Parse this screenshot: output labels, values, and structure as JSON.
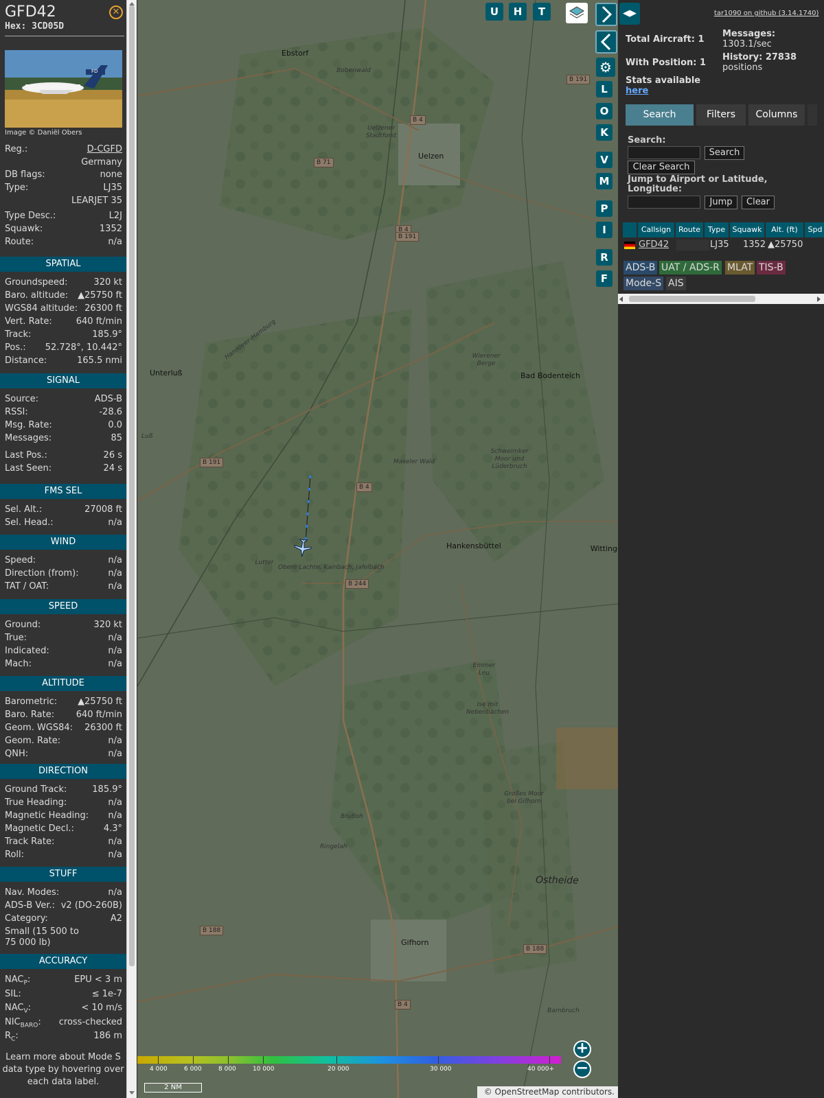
{
  "aircraft": {
    "callsign": "GFD42",
    "hex_label": "Hex: 3CD05D",
    "image_credit": "Image © Daniël Obers",
    "photo_tail_text": "FD",
    "info_rows": [
      {
        "label": "Reg.:",
        "value": "D-CGFD"
      },
      {
        "label": "",
        "value": "Germany"
      },
      {
        "label": "DB flags:",
        "value": "none"
      },
      {
        "label": "Type:",
        "value": "LJ35"
      },
      {
        "label": "",
        "value": "LEARJET 35"
      },
      {
        "label": "Type Desc.:",
        "value": "L2J"
      },
      {
        "label": "Squawk:",
        "value": "1352"
      },
      {
        "label": "Route:",
        "value": "n/a"
      }
    ]
  },
  "sections": [
    {
      "title": "SPATIAL",
      "rows": [
        {
          "label": "Groundspeed:",
          "value": "320 kt"
        },
        {
          "label": "Baro. altitude:",
          "value": "▲25750 ft"
        },
        {
          "label": "WGS84 altitude:",
          "value": "26300 ft"
        },
        {
          "label": "Vert. Rate:",
          "value": "640 ft/min"
        },
        {
          "label": "Track:",
          "value": "185.9°"
        },
        {
          "label": "Pos.:",
          "value": "52.728°, 10.442°"
        },
        {
          "label": "Distance:",
          "value": "165.5 nmi"
        }
      ]
    },
    {
      "title": "SIGNAL",
      "rows": [
        {
          "label": "Source:",
          "value": "ADS-B"
        },
        {
          "label": "RSSI:",
          "value": "-28.6"
        },
        {
          "label": "Msg. Rate:",
          "value": "0.0"
        },
        {
          "label": "Messages:",
          "value": "85"
        },
        {
          "label": "Last Pos.:",
          "value": "26 s"
        },
        {
          "label": "Last Seen:",
          "value": "24 s"
        }
      ]
    },
    {
      "title": "FMS SEL",
      "rows": [
        {
          "label": "Sel. Alt.:",
          "value": "27008 ft"
        },
        {
          "label": "Sel. Head.:",
          "value": "n/a"
        }
      ]
    },
    {
      "title": "WIND",
      "rows": [
        {
          "label": "Speed:",
          "value": "n/a"
        },
        {
          "label": "Direction (from):",
          "value": "n/a"
        },
        {
          "label": "TAT / OAT:",
          "value": "n/a"
        }
      ]
    },
    {
      "title": "SPEED",
      "rows": [
        {
          "label": "Ground:",
          "value": "320 kt"
        },
        {
          "label": "True:",
          "value": "n/a"
        },
        {
          "label": "Indicated:",
          "value": "n/a"
        },
        {
          "label": "Mach:",
          "value": "n/a"
        }
      ]
    },
    {
      "title": "ALTITUDE",
      "rows": [
        {
          "label": "Barometric:",
          "value": "▲25750 ft"
        },
        {
          "label": "Baro. Rate:",
          "value": "640 ft/min"
        },
        {
          "label": "Geom. WGS84:",
          "value": "26300 ft"
        },
        {
          "label": "Geom. Rate:",
          "value": "n/a"
        },
        {
          "label": "QNH:",
          "value": "n/a"
        }
      ]
    },
    {
      "title": "DIRECTION",
      "rows": [
        {
          "label": "Ground Track:",
          "value": "185.9°"
        },
        {
          "label": "True Heading:",
          "value": "n/a"
        },
        {
          "label": "Magnetic Heading:",
          "value": "n/a"
        },
        {
          "label": "Magnetic Decl.:",
          "value": "4.3°"
        },
        {
          "label": "Track Rate:",
          "value": "n/a"
        },
        {
          "label": "Roll:",
          "value": "n/a"
        }
      ]
    },
    {
      "title": "STUFF",
      "rows": [
        {
          "label": "Nav. Modes:",
          "value": "n/a"
        },
        {
          "label": "ADS-B Ver.:",
          "value": "v2 (DO-260B)"
        },
        {
          "label": "Category:",
          "value": "A2"
        },
        {
          "label": "Small (15 500 to",
          "value": ""
        },
        {
          "label": "75 000 lb)",
          "value": ""
        }
      ]
    },
    {
      "title": "ACCURACY",
      "rows": [
        {
          "label": "NAC",
          "sub": "P",
          "tail": ":",
          "value": "EPU < 3 m"
        },
        {
          "label": "SIL:",
          "value": "≤ 1e-7"
        },
        {
          "label": "NAC",
          "sub": "V",
          "tail": ":",
          "value": "< 10 m/s"
        },
        {
          "label": "NIC",
          "sub": "BARO",
          "tail": ":",
          "value": "cross-checked"
        },
        {
          "label": "R",
          "sub": "C",
          "tail": ":",
          "value": "186 m"
        }
      ]
    }
  ],
  "learn_more": "Learn more about Mode S data type by hovering over each data label.",
  "map": {
    "top_buttons": [
      "U",
      "H",
      "T"
    ],
    "side_buttons": [
      "L",
      "O",
      "K",
      "V",
      "M",
      "P",
      "I",
      "R",
      "F"
    ],
    "colorbar_ticks": [
      "4 000",
      "6 000",
      "8 000",
      "10 000",
      "20 000",
      "30 000",
      "40 000+"
    ],
    "scale": "2 NM",
    "attribution": "© OpenStreetMap contributors.",
    "places": [
      {
        "name": "Ebstorf",
        "cls": "town"
      },
      {
        "name": "Bobenwald",
        "cls": "area"
      },
      {
        "name": "Uelzener Stadtforst",
        "cls": "area"
      },
      {
        "name": "Uelzen",
        "cls": "town"
      },
      {
        "name": "Unterluß",
        "cls": "town"
      },
      {
        "name": "Wierener Berge",
        "cls": "area"
      },
      {
        "name": "Bad Bodenteich",
        "cls": "town"
      },
      {
        "name": "Maseler Wald",
        "cls": "area"
      },
      {
        "name": "Schweimker Moor und Lüderbruch",
        "cls": "area"
      },
      {
        "name": "Hankensbüttel",
        "cls": "town"
      },
      {
        "name": "Wittinger",
        "cls": "town"
      },
      {
        "name": "Lutter",
        "cls": "area"
      },
      {
        "name": "Obere Lachte, Kainbach, Jafelbach",
        "cls": "area"
      },
      {
        "name": "Emmer Leu",
        "cls": "area"
      },
      {
        "name": "Ise mit Nebenbächen",
        "cls": "area"
      },
      {
        "name": "Großes Moor bei Gifhorn",
        "cls": "area"
      },
      {
        "name": "Brutloh",
        "cls": "area"
      },
      {
        "name": "Ringelah",
        "cls": "area"
      },
      {
        "name": "Ostheide",
        "cls": "region"
      },
      {
        "name": "Gifhorn",
        "cls": "town"
      },
      {
        "name": "Barnbruch",
        "cls": "area"
      },
      {
        "name": "Hannover–Hamburg",
        "cls": "rail"
      },
      {
        "name": "Luß",
        "cls": "area"
      }
    ],
    "roads": [
      "B 191",
      "B 4",
      "B 71",
      "B 4",
      "B 191",
      "B 191",
      "B 4",
      "B 244",
      "B 188",
      "B 188",
      "B 4"
    ]
  },
  "panel": {
    "github": "tar1090 on github (3.14.1740)",
    "total_aircraft": "Total Aircraft: 1",
    "with_position": "With Position: 1",
    "messages_label": "Messages:",
    "messages_value": "1303.1/sec",
    "history_label": "History: 27838",
    "history_value": "positions",
    "stats_label": "Stats available",
    "stats_link": "here",
    "tabs": [
      "Search",
      "Filters",
      "Columns"
    ],
    "search_label": "Search:",
    "search_button": "Search",
    "clear_search": "Clear Search",
    "jump_label": "Jump to Airport or Latitude, Longitude:",
    "jump_button": "Jump",
    "clear_button": "Clear",
    "columns": [
      "",
      "Callsign",
      "Route",
      "Type",
      "Squawk",
      "Alt. (ft)",
      "Spd"
    ],
    "row": {
      "callsign": "GFD42",
      "route": "",
      "type": "LJ35",
      "squawk": "1352",
      "alt": "▲25750"
    },
    "sources": [
      {
        "label": "ADS-B",
        "color": "#2a4a6a"
      },
      {
        "label": "UAT / ADS-R",
        "color": "#2f6a3a"
      },
      {
        "label": "MLAT",
        "color": "#6a5a30"
      },
      {
        "label": "TIS-B",
        "color": "#6a2a40"
      },
      {
        "label": "Mode-S",
        "color": "#344a66"
      },
      {
        "label": "AIS",
        "color": "#3b3b3b"
      }
    ]
  }
}
